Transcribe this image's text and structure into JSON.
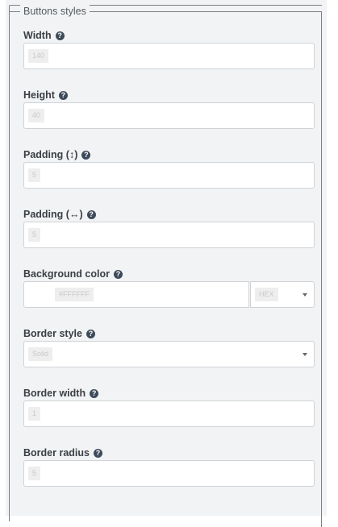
{
  "section": {
    "legend": "Buttons styles"
  },
  "help_icon_glyph": "?",
  "fields": {
    "width": {
      "label": "Width",
      "value": "140"
    },
    "height": {
      "label": "Height",
      "value": "40"
    },
    "padding_v": {
      "label": "Padding (↕)",
      "value": "5"
    },
    "padding_h": {
      "label": "Padding (↔)",
      "value": "5"
    },
    "background_color": {
      "label": "Background color",
      "value": "#FFFFFF",
      "format": "HEX",
      "swatch_color": "#ffffff"
    },
    "border_style": {
      "label": "Border style",
      "value": "Solid"
    },
    "border_width": {
      "label": "Border width",
      "value": "1"
    },
    "border_radius": {
      "label": "Border radius",
      "value": "5"
    }
  }
}
